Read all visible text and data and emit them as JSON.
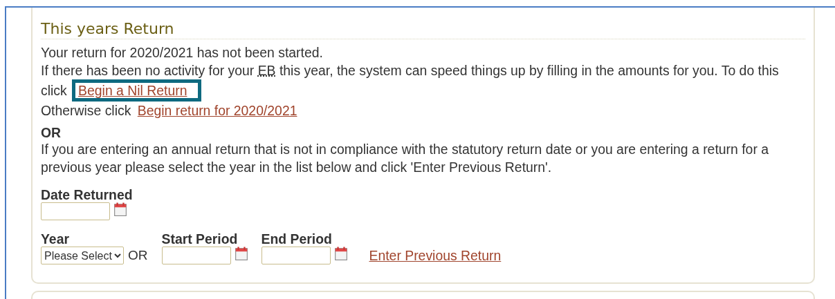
{
  "section": {
    "title": "This years Return",
    "status": "Your return for 2020/2021 has not been started.",
    "nil_paragraph": {
      "before": "If there has been no activity for your ",
      "abbr": "EB",
      "after": " this year, the system can speed things up by filling in the amounts for you. To do this click ",
      "link": "Begin a Nil Return"
    },
    "otherwise": {
      "text": "Otherwise click ",
      "link": "Begin return for 2020/2021"
    },
    "or_heading": "OR",
    "previous_text": "If you are entering an annual return that is not in compliance with the statutory return date or you are entering a return for a previous year please select the year in the list below and click 'Enter Previous Return'.",
    "date_returned": {
      "label": "Date Returned"
    },
    "year": {
      "label": "Year",
      "value": "Please Select"
    },
    "or_label": "OR",
    "start_period": {
      "label": "Start Period"
    },
    "end_period": {
      "label": "End Period"
    },
    "enter_link": "Enter Previous Return"
  },
  "highlight": {
    "shown": true
  }
}
